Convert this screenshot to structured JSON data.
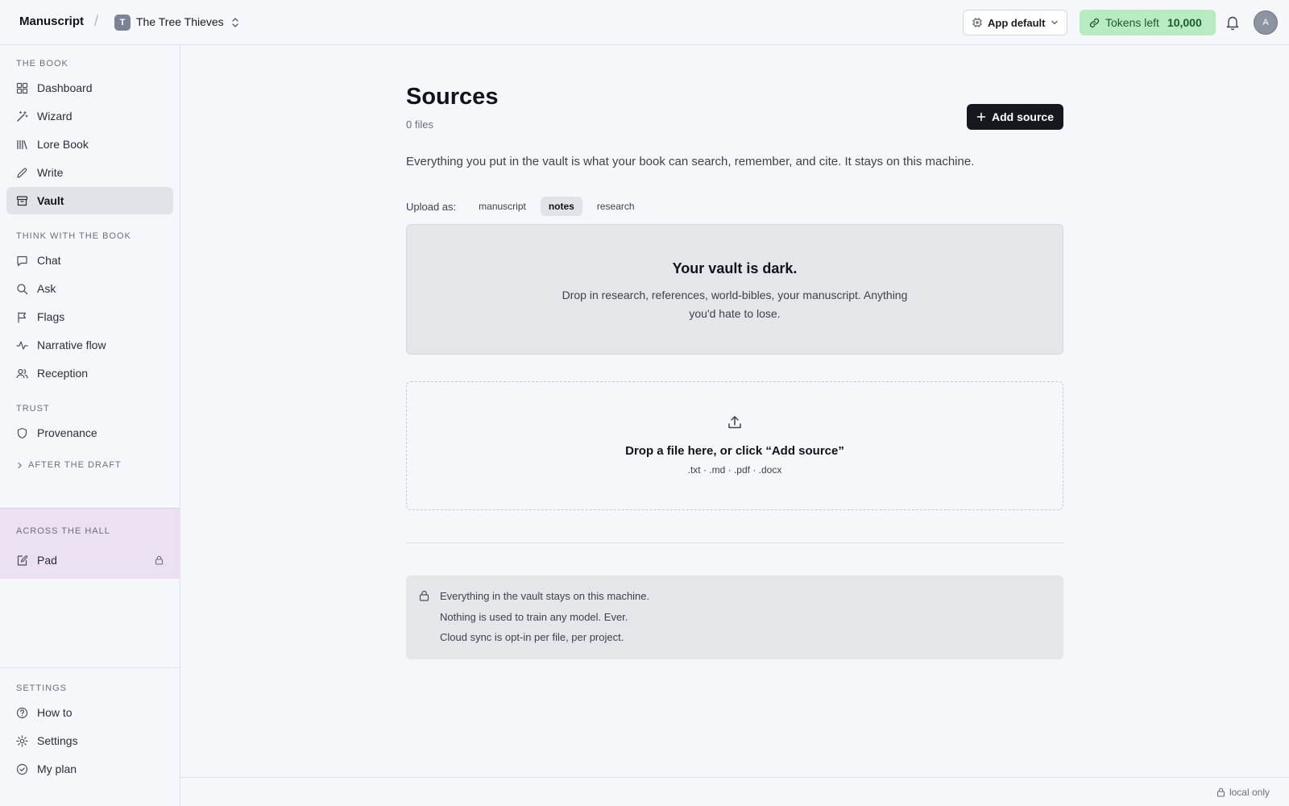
{
  "header": {
    "brand": "Manuscript",
    "separator": "/",
    "project_initial": "T",
    "project_name": "The Tree Thieves",
    "model_label": "App default",
    "tokens_label": "Tokens left",
    "tokens_value": "10,000",
    "avatar_initial": "A"
  },
  "sidebar": {
    "sections": {
      "book": "THE BOOK",
      "think": "THINK WITH THE BOOK",
      "trust": "TRUST",
      "after": "AFTER THE DRAFT",
      "hall": "ACROSS THE HALL",
      "settings": "SETTINGS"
    },
    "items": {
      "dashboard": "Dashboard",
      "wizard": "Wizard",
      "lore": "Lore Book",
      "write": "Write",
      "vault": "Vault",
      "chat": "Chat",
      "ask": "Ask",
      "flags": "Flags",
      "narrative": "Narrative flow",
      "reception": "Reception",
      "provenance": "Provenance",
      "pad": "Pad",
      "howto": "How to",
      "settings": "Settings",
      "plan": "My plan"
    },
    "active_item": "Vault"
  },
  "main": {
    "title": "Sources",
    "file_count": "0 files",
    "add_button": "Add source",
    "intro": "Everything you put in the vault is what your book can search, remember, and cite. It stays on this machine.",
    "upload_label": "Upload as:",
    "upload_options": [
      "manuscript",
      "notes",
      "research"
    ],
    "upload_selected": "notes",
    "empty_title": "Your vault is dark.",
    "empty_text": "Drop in research, references, world-bibles, your manuscript. Anything you'd hate to lose.",
    "drop_title": "Drop a file here, or click “Add source”",
    "drop_formats": ".txt · .md · .pdf · .docx",
    "privacy": [
      "Everything in the vault stays on this machine.",
      "Nothing is used to train any model. Ever.",
      "Cloud sync is opt-in per file, per project."
    ]
  },
  "footer": {
    "status": "local only"
  },
  "colors": {
    "accent_dark": "#15181e",
    "tokens_bg": "#b9ebc3",
    "tokens_text": "#1b5b2b",
    "hall_bg": "#ebe1f2",
    "active_nav_bg": "#e1e3e8"
  }
}
